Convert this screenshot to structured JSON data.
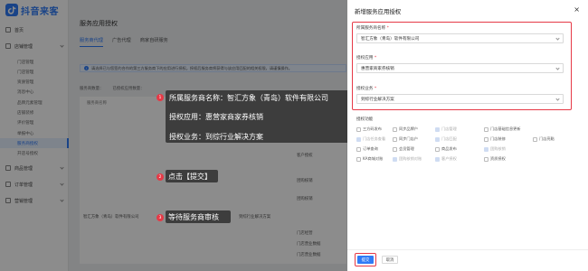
{
  "brand": {
    "name": "抖音来客"
  },
  "sidebar": {
    "items": [
      {
        "label": "首页",
        "type": "group"
      },
      {
        "label": "店铺管理",
        "type": "group"
      },
      {
        "label": "门店管理",
        "type": "sub"
      },
      {
        "label": "门店管理",
        "type": "sub"
      },
      {
        "label": "资质管理",
        "type": "sub"
      },
      {
        "label": "消息中心",
        "type": "sub"
      },
      {
        "label": "品牌元素管理",
        "type": "sub"
      },
      {
        "label": "店铺装修",
        "type": "sub"
      },
      {
        "label": "评价管理",
        "type": "sub"
      },
      {
        "label": "举报中心",
        "type": "sub"
      },
      {
        "label": "服务商授权",
        "type": "sub",
        "active": true
      },
      {
        "label": "开店号授权",
        "type": "sub"
      },
      {
        "label": "商品管理",
        "type": "group"
      },
      {
        "label": "订单管理",
        "type": "group"
      },
      {
        "label": "营销管理",
        "type": "group"
      }
    ]
  },
  "main": {
    "title": "服务应用授权",
    "tabs": [
      {
        "label": "服务商代理",
        "active": true
      },
      {
        "label": "广告代理",
        "active": false
      },
      {
        "label": "商家自研服务",
        "active": false
      }
    ],
    "notice": "请选择已与您签约合作的第三方服务商下的应用进行授权。授权后服务商将获得与该应用匹配的相关权限，请谨慎操作。",
    "counts": [
      "服务商数量：",
      "已授权应用数量："
    ],
    "table": {
      "headers": [
        "服务商名称"
      ],
      "row": [
        "智汇方象（青岛）软件有限公司",
        "惠营家商家券核销",
        "到综行业解决方案",
        "门店经营"
      ],
      "right_col": [
        "门店经营",
        "客户授权",
        "团购核销",
        "团购核销",
        "门店经营",
        "门店营业数据",
        "门店营业数据"
      ]
    }
  },
  "drawer": {
    "title": "新增服务应用授权",
    "close_glyph": "×",
    "fields": [
      {
        "label": "所属服务商名称",
        "required_mark": "*",
        "value": "智汇方象（青岛）软件有限公司"
      },
      {
        "label": "授权应用",
        "required_mark": "*",
        "value": "惠营家商家券核销"
      },
      {
        "label": "授权业务",
        "required_mark": "*",
        "value": "到综行业解决方案"
      }
    ],
    "perms_label": "授权功能",
    "perms": [
      {
        "label": "三方码发布",
        "checked": false
      },
      {
        "label": "同步品牌户",
        "checked": false
      },
      {
        "label": "门店管理",
        "checked": true
      },
      {
        "label": "门店基础信息更新",
        "checked": false
      },
      {
        "label": "门店任务查看",
        "checked": true
      },
      {
        "label": "同步门店户",
        "checked": false
      },
      {
        "label": "门店匹配",
        "checked": true
      },
      {
        "label": "门店装修",
        "checked": false
      },
      {
        "label": "门店亮點",
        "checked": false
      },
      {
        "label": "订单查询",
        "checked": false
      },
      {
        "label": "会员管理",
        "checked": false
      },
      {
        "label": "商品发布",
        "checked": false
      },
      {
        "label": "团购核销",
        "checked": true
      },
      {
        "label": "KA商城对账",
        "checked": false
      },
      {
        "label": "团购核销对账",
        "checked": true
      },
      {
        "label": "客户授权",
        "checked": true
      },
      {
        "label": "资质授权",
        "checked": false
      }
    ],
    "submit_label": "提交",
    "cancel_label": "取消"
  },
  "callouts": [
    {
      "num": "1",
      "lines": [
        "所属服务商名称：智汇方象（青岛）软件有限公司",
        "授权应用：惠营家商家券核销",
        "授权业务：到综行业解决方案"
      ]
    },
    {
      "num": "2",
      "lines": [
        "点击【提交】"
      ]
    },
    {
      "num": "3",
      "lines": [
        "等待服务商审核"
      ]
    }
  ],
  "colors": {
    "accent": "#2f7bf6",
    "highlight": "#e63946",
    "callout_bg": "#3d3d3d"
  }
}
